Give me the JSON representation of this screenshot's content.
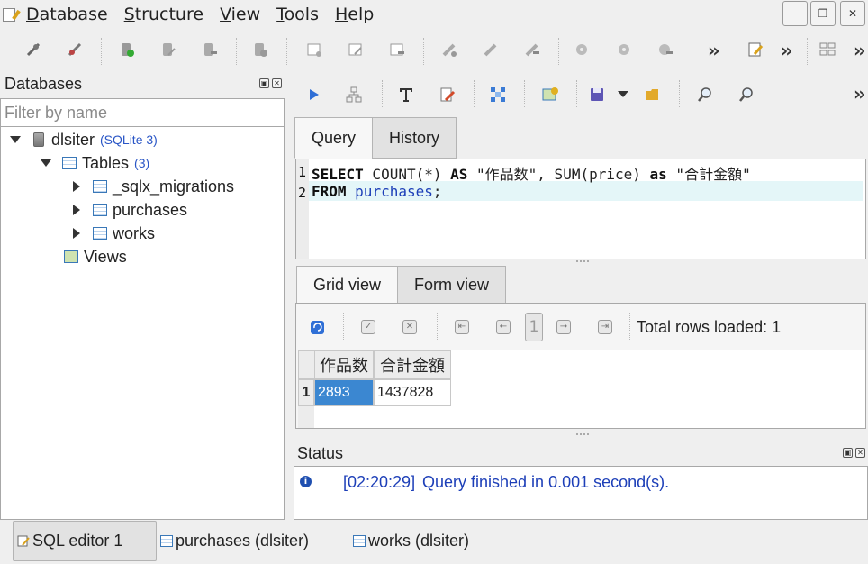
{
  "menubar": {
    "items": [
      {
        "underline": "D",
        "rest": "atabase"
      },
      {
        "underline": "S",
        "rest": "tructure"
      },
      {
        "underline": "V",
        "rest": "iew"
      },
      {
        "underline": "T",
        "rest": "ools"
      },
      {
        "underline": "H",
        "rest": "elp"
      }
    ],
    "window_buttons": [
      "minimize",
      "restore",
      "close"
    ]
  },
  "left_panel": {
    "title": "Databases",
    "filter_placeholder": "Filter by name",
    "tree": {
      "database": {
        "name": "dlsiter",
        "type": "(SQLite 3)"
      },
      "tables": {
        "label": "Tables",
        "count": "(3)",
        "items": [
          "_sqlx_migrations",
          "purchases",
          "works"
        ]
      },
      "views": {
        "label": "Views"
      }
    }
  },
  "editor": {
    "tabs": [
      "Query",
      "History"
    ],
    "active_tab": "Query",
    "lines": [
      {
        "num": "1"
      },
      {
        "num": "2"
      }
    ],
    "sql": {
      "l1_kw1": "SELECT",
      "l1_a": " COUNT(*) ",
      "l1_kw2": "AS",
      "l1_b": " \"作品数\", SUM(price) ",
      "l1_kw3": "as",
      "l1_c": " \"合計金額\"",
      "l2_kw1": "FROM",
      "l2_a": " ",
      "l2_table": "purchases",
      "l2_b": ";"
    }
  },
  "results": {
    "tabs": [
      "Grid view",
      "Form view"
    ],
    "active_tab": "Grid view",
    "page": "1",
    "rows_loaded": "Total rows loaded: 1",
    "columns": [
      "作品数",
      "合計金額"
    ],
    "rows": [
      {
        "num": "1",
        "cells": [
          "2893",
          "1437828"
        ]
      }
    ]
  },
  "status": {
    "title": "Status",
    "time": "[02:20:29]",
    "message": "Query finished in 0.001 second(s)."
  },
  "bottom_tabs": [
    {
      "label": "SQL editor 1",
      "active": true
    },
    {
      "label": "purchases (dlsiter)",
      "active": false
    },
    {
      "label": "works (dlsiter)",
      "active": false
    }
  ],
  "colors": {
    "accent_blue": "#1d3fb8",
    "selection": "#3b87d1",
    "current_line": "#e4f6f8"
  }
}
